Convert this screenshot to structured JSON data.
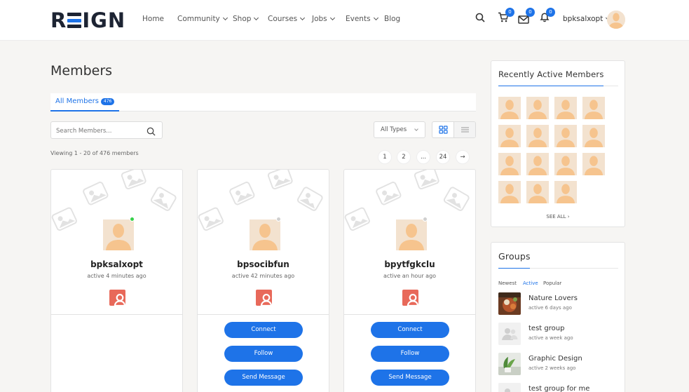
{
  "header": {
    "logo": {
      "pre": "R",
      "post": "IGN"
    },
    "nav": [
      {
        "label": "Home",
        "dropdown": false
      },
      {
        "label": "Community",
        "dropdown": true
      },
      {
        "label": "Shop",
        "dropdown": true
      },
      {
        "label": "Courses",
        "dropdown": true
      },
      {
        "label": "Jobs",
        "dropdown": true
      },
      {
        "label": "Events",
        "dropdown": true
      },
      {
        "label": "Blog",
        "dropdown": false
      }
    ],
    "cart_count": "0",
    "messages_count": "0",
    "notifications_count": "0",
    "username": "bpksalxopt"
  },
  "main": {
    "title": "Members",
    "tab_label": "All Members",
    "tab_count": "476",
    "search_placeholder": "Search Members...",
    "type_filter": "All Types",
    "viewing": "Viewing 1 - 20 of 476 members",
    "pagination": [
      "1",
      "2",
      "...",
      "24",
      "→"
    ],
    "members": [
      {
        "name": "bpksalxopt",
        "active": "active 4 minutes ago",
        "online": true,
        "actions": []
      },
      {
        "name": "bpsocibfun",
        "active": "active 42 minutes ago",
        "online": false,
        "actions": [
          "Connect",
          "Follow",
          "Send Message"
        ]
      },
      {
        "name": "bpytfgkclu",
        "active": "active an hour ago",
        "online": false,
        "actions": [
          "Connect",
          "Follow",
          "Send Message"
        ]
      }
    ]
  },
  "sidebar": {
    "recently_active_title": "Recently Active Members",
    "recently_active_count": 15,
    "see_all": "SEE ALL",
    "groups_title": "Groups",
    "group_tabs": [
      "Newest",
      "Active",
      "Popular"
    ],
    "group_tab_selected": "Active",
    "groups": [
      {
        "name": "Nature Lovers",
        "active": "active 6 days ago",
        "image": "food-photo"
      },
      {
        "name": "test group",
        "active": "active a week ago",
        "image": "group-placeholder"
      },
      {
        "name": "Graphic Design",
        "active": "active 2 weeks ago",
        "image": "plant-photo"
      },
      {
        "name": "test group for me",
        "active": "",
        "image": "group-placeholder"
      }
    ]
  },
  "colors": {
    "accent": "#1e73e8",
    "profile_button": "#e8695a",
    "online": "#36d14a",
    "avatar_bg": "#f3e2cf",
    "avatar_fg": "#f6c48e"
  }
}
